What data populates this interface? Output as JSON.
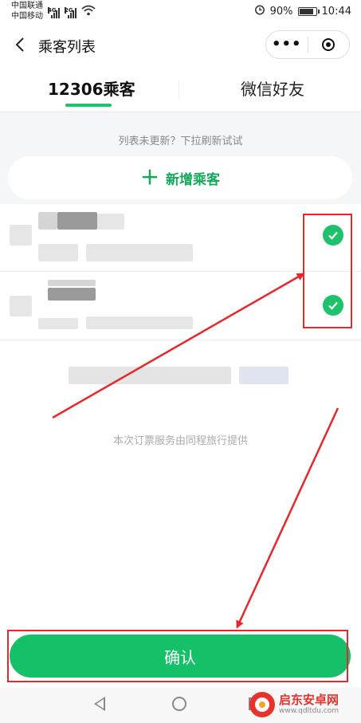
{
  "status_bar": {
    "carrier_1": "中国联通",
    "carrier_2": "中国移动",
    "net_1": "4G",
    "net_2": "2G",
    "battery_pct": "90%",
    "battery_level": 0.9,
    "time": "10:44"
  },
  "nav": {
    "title": "乘客列表",
    "more_label": "•••"
  },
  "tabs": [
    {
      "label": "12306乘客",
      "active": true
    },
    {
      "label": "微信好友",
      "active": false
    }
  ],
  "list": {
    "hint": "列表未更新？下拉刷新试试",
    "add_label": "新增乘客",
    "add_icon": "＋",
    "selected_count": 2
  },
  "footer_note": "本次订票服务由同程旅行提供",
  "confirm_label": "确认",
  "watermark": {
    "title": "启东安卓网",
    "url": "www.qdltdu.com"
  },
  "colors": {
    "accent": "#14c168",
    "annotation": "#e8262b"
  }
}
